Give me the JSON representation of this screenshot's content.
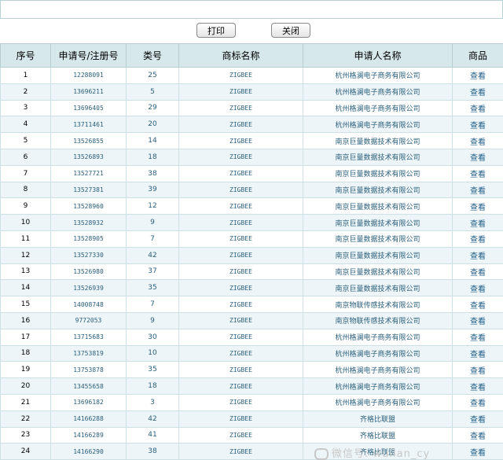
{
  "toolbar": {
    "print_label": "打印",
    "close_label": "关闭"
  },
  "table": {
    "headers": [
      "序号",
      "申请号/注册号",
      "类号",
      "商标名称",
      "申请人名称",
      "商品"
    ],
    "rows": [
      [
        "1",
        "12288091",
        "25",
        "ZIGBEE",
        "杭州格澜电子商务有限公司",
        "查看"
      ],
      [
        "2",
        "13696211",
        "5",
        "ZIGBEE",
        "杭州格澜电子商务有限公司",
        "查看"
      ],
      [
        "3",
        "13696405",
        "29",
        "ZIGBEE",
        "杭州格澜电子商务有限公司",
        "查看"
      ],
      [
        "4",
        "13711461",
        "20",
        "ZIGBEE",
        "杭州格澜电子商务有限公司",
        "查看"
      ],
      [
        "5",
        "13526855",
        "14",
        "ZIGBEE",
        "南京巨量数据技术有限公司",
        "查看"
      ],
      [
        "6",
        "13526893",
        "18",
        "ZIGBEE",
        "南京巨量数据技术有限公司",
        "查看"
      ],
      [
        "7",
        "13527721",
        "38",
        "ZIGBEE",
        "南京巨量数据技术有限公司",
        "查看"
      ],
      [
        "8",
        "13527381",
        "39",
        "ZIGBEE",
        "南京巨量数据技术有限公司",
        "查看"
      ],
      [
        "9",
        "13528960",
        "12",
        "ZIGBEE",
        "南京巨量数据技术有限公司",
        "查看"
      ],
      [
        "10",
        "13528932",
        "9",
        "ZIGBEE",
        "南京巨量数据技术有限公司",
        "查看"
      ],
      [
        "11",
        "13528905",
        "7",
        "ZIGBEE",
        "南京巨量数据技术有限公司",
        "查看"
      ],
      [
        "12",
        "13527330",
        "42",
        "ZIGBEE",
        "南京巨量数据技术有限公司",
        "查看"
      ],
      [
        "13",
        "13526980",
        "37",
        "ZIGBEE",
        "南京巨量数据技术有限公司",
        "查看"
      ],
      [
        "14",
        "13526939",
        "35",
        "ZIGBEE",
        "南京巨量数据技术有限公司",
        "查看"
      ],
      [
        "15",
        "14008748",
        "7",
        "ZIGBEE",
        "南京物联传感技术有限公司",
        "查看"
      ],
      [
        "16",
        "9772053",
        "9",
        "ZIGBEE",
        "南京物联传感技术有限公司",
        "查看"
      ],
      [
        "17",
        "13715683",
        "30",
        "ZIGBEE",
        "杭州格澜电子商务有限公司",
        "查看"
      ],
      [
        "18",
        "13753819",
        "10",
        "ZIGBEE",
        "杭州格澜电子商务有限公司",
        "查看"
      ],
      [
        "19",
        "13753878",
        "35",
        "ZIGBEE",
        "杭州格澜电子商务有限公司",
        "查看"
      ],
      [
        "20",
        "13455658",
        "18",
        "ZIGBEE",
        "杭州格澜电子商务有限公司",
        "查看"
      ],
      [
        "21",
        "13696182",
        "3",
        "ZIGBEE",
        "杭州格澜电子商务有限公司",
        "查看"
      ],
      [
        "22",
        "14166288",
        "42",
        "ZIGBEE",
        "齐格比联盟",
        "查看"
      ],
      [
        "23",
        "14166289",
        "41",
        "ZIGBEE",
        "齐格比联盟",
        "查看"
      ],
      [
        "24",
        "14166290",
        "38",
        "ZIGBEE",
        "齐格比联盟",
        "查看"
      ]
    ]
  },
  "watermark": {
    "text": "微信号: wulian_cy"
  }
}
